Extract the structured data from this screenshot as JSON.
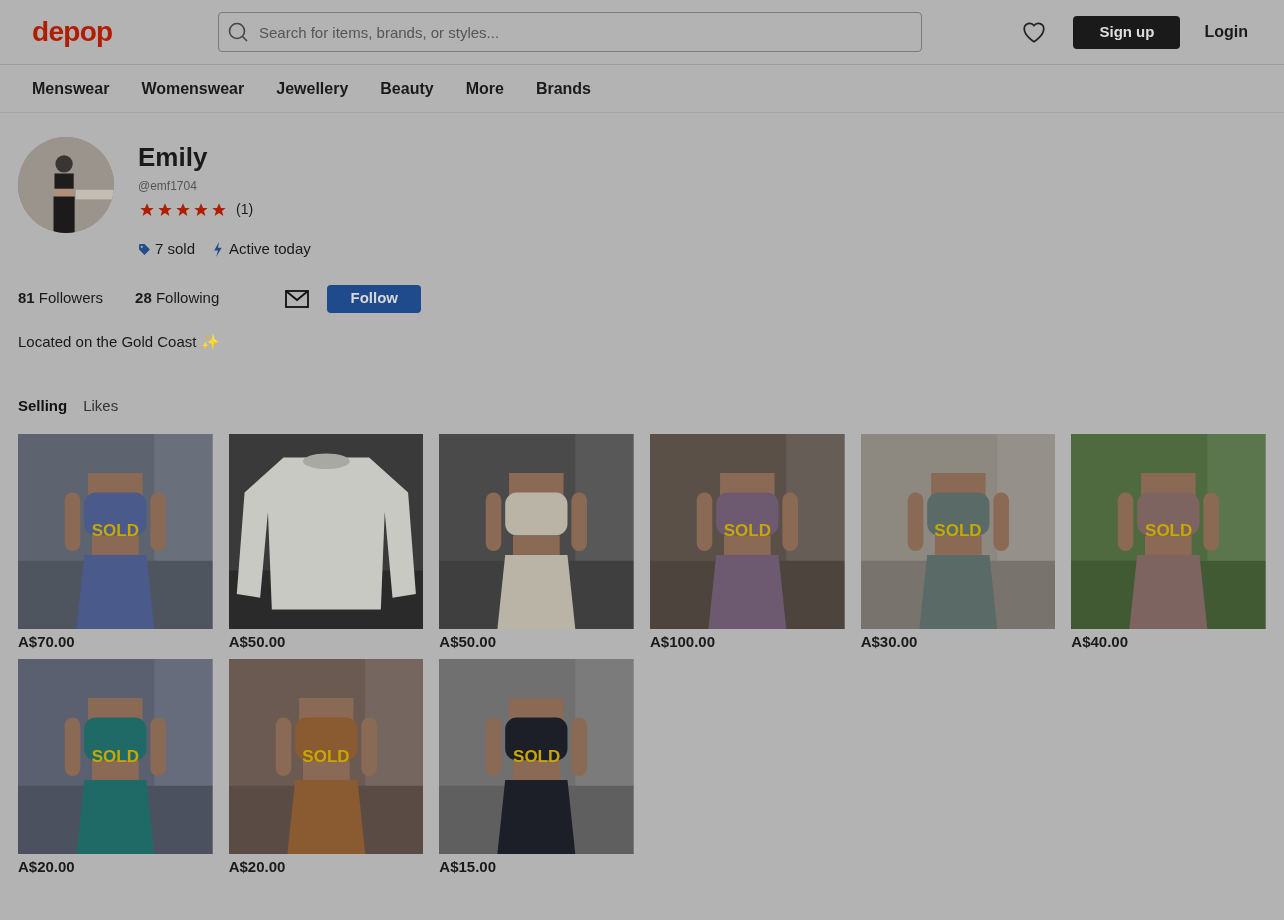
{
  "header": {
    "logo": "depop",
    "search": {
      "placeholder": "Search for items, brands, or styles..."
    },
    "signup": "Sign up",
    "login": "Login"
  },
  "nav": [
    "Menswear",
    "Womenswear",
    "Jewellery",
    "Beauty",
    "More",
    "Brands"
  ],
  "profile": {
    "name": "Emily",
    "handle": "@emf1704",
    "stars": 5,
    "rating_count": "(1)",
    "sold": "7 sold",
    "activity": "Active today",
    "followers_count": "81",
    "followers_label": "Followers",
    "following_count": "28",
    "following_label": "Following",
    "follow": "Follow",
    "bio": "Located on the Gold Coast ✨"
  },
  "tabs": [
    {
      "label": "Selling",
      "selected": true
    },
    {
      "label": "Likes",
      "selected": false
    }
  ],
  "products": [
    {
      "price": "A$70.00",
      "badge": "SOLD"
    },
    {
      "price": "A$50.00"
    },
    {
      "price": "A$50.00"
    },
    {
      "price": "A$100.00",
      "badge": "SOLD"
    },
    {
      "price": "A$30.00",
      "badge": "SOLD"
    },
    {
      "price": "A$40.00",
      "badge": "SOLD"
    },
    {
      "price": "A$20.00",
      "badge": "SOLD"
    },
    {
      "price": "A$20.00",
      "badge": "SOLD"
    },
    {
      "price": "A$15.00",
      "badge": "SOLD"
    }
  ]
}
